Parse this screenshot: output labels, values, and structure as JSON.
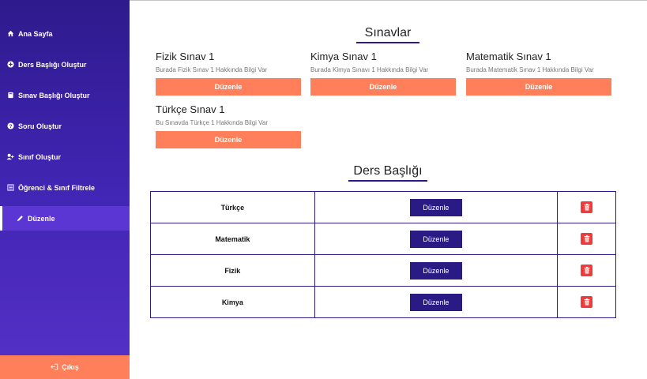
{
  "sidebar": {
    "items": [
      {
        "label": "Ana Sayfa",
        "icon": "home-icon"
      },
      {
        "label": "Ders Başlığı Oluştur",
        "icon": "plus-circle-icon"
      },
      {
        "label": "Sınav Başlığı Oluştur",
        "icon": "book-icon"
      },
      {
        "label": "Soru Oluştur",
        "icon": "question-circle-icon"
      },
      {
        "label": "Sınıf Oluştur",
        "icon": "user-plus-icon"
      },
      {
        "label": "Öğrenci & Sınıf Filtrele",
        "icon": "list-icon"
      },
      {
        "label": "Düzenle",
        "icon": "pencil-icon",
        "active": true
      }
    ],
    "logout_label": "Çıkış"
  },
  "exams": {
    "title": "Sınavlar",
    "cards": [
      {
        "name": "Fizik Sınav 1",
        "desc": "Burada Fizik Sınav 1 Hakkında Bilgi Var",
        "button": "Düzenle"
      },
      {
        "name": "Kimya Sınav 1",
        "desc": "Burada Kimya Sınavı 1 Hakkında Bilgi Var",
        "button": "Düzenle"
      },
      {
        "name": "Matematik Sınav 1",
        "desc": "Burada Matematik Sınav 1 Hakkında Bilgi Var",
        "button": "Düzenle"
      },
      {
        "name": "Türkçe Sınav 1",
        "desc": "Bu Sınavda Türkçe 1 Hakkında Bilgi Var",
        "button": "Düzenle"
      }
    ]
  },
  "courses": {
    "title": "Ders Başlığı",
    "rows": [
      {
        "name": "Türkçe",
        "button": "Düzenle"
      },
      {
        "name": "Matematik",
        "button": "Düzenle"
      },
      {
        "name": "Fizik",
        "button": "Düzenle"
      },
      {
        "name": "Kimya",
        "button": "Düzenle"
      }
    ]
  },
  "colors": {
    "sidebar_top": "#2e1a8c",
    "sidebar_bottom": "#5531c8",
    "accent_orange": "#ff7f5a",
    "primary_purple": "#2a1a84",
    "delete_red": "#ee3b3b"
  }
}
